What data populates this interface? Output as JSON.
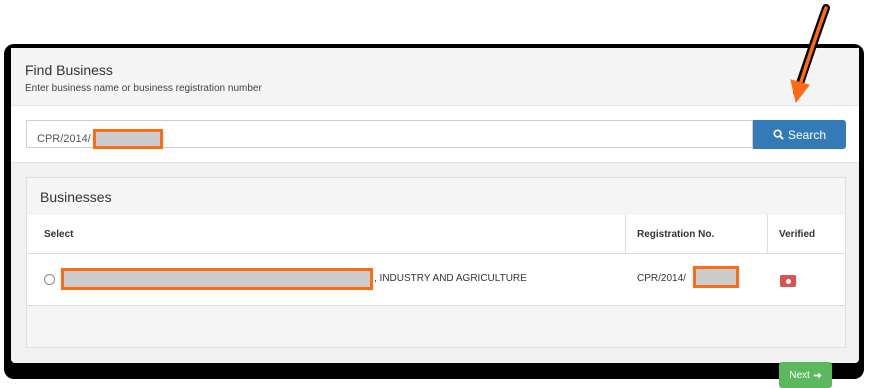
{
  "header": {
    "title": "Find Business",
    "subtitle": "Enter business name or business registration number"
  },
  "search": {
    "value_prefix": "CPR/2014/",
    "button_label": "Search"
  },
  "businesses": {
    "title": "Businesses",
    "columns": [
      "Select",
      "Registration No.",
      "Verified"
    ],
    "rows": [
      {
        "name_suffix": ", INDUSTRY AND AGRICULTURE",
        "registration_prefix": "CPR/2014/",
        "verified": false
      }
    ]
  },
  "footer": {
    "next_label": "Next"
  },
  "colors": {
    "primary": "#337ab7",
    "success": "#5cb85c",
    "danger": "#d9534f",
    "annotation": "#ff6a13"
  }
}
